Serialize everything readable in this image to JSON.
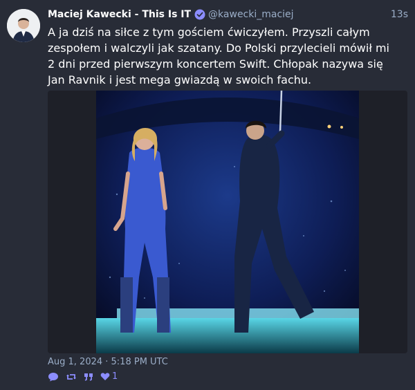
{
  "post": {
    "display_name": "Maciej Kawecki - This Is IT",
    "handle": "@kawecki_maciej",
    "relative_time": "13s",
    "content": "A ja dziś na siłce z tym gościem ćwiczyłem. Przyszli całym\nzespołem i walczyli jak szatany. Do Polski przylecieli mówił mi\n2 dni przed pierwszym koncertem Swift. Chłopak nazywa się\nJan Ravnik i jest mega gwiazdą w swoich fachu.",
    "timestamp": "Aug 1, 2024 · 5:18 PM UTC",
    "favourite_count": "1"
  },
  "icons": {
    "verified": "verified-badge-icon",
    "reply": "speech-bubble-icon",
    "boost": "retweet-icon",
    "quote": "quote-icon",
    "favourite": "heart-icon"
  },
  "colors": {
    "background": "#282c37",
    "accent": "#8c8dff",
    "muted": "#9baec8"
  }
}
